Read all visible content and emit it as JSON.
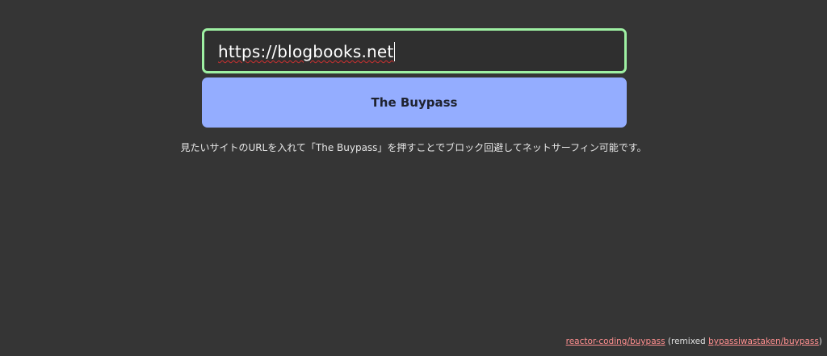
{
  "url_input": {
    "value": "https://blogbooks.net",
    "border_color": "#9ef0a3"
  },
  "go_button": {
    "label": "The Buypass",
    "color": "#94adff"
  },
  "hint_text": "見たいサイトのURLを入れて「The Buypass」を押すことでブロック回避してネットサーフィン可能です。",
  "footer": {
    "link1": "reactor-coding/buypass",
    "middle_open": " (remixed ",
    "link2": "bypassiwastaken/buypass",
    "middle_close": ")",
    "link_color": "#ff8f8f"
  },
  "background_color": "#353535"
}
